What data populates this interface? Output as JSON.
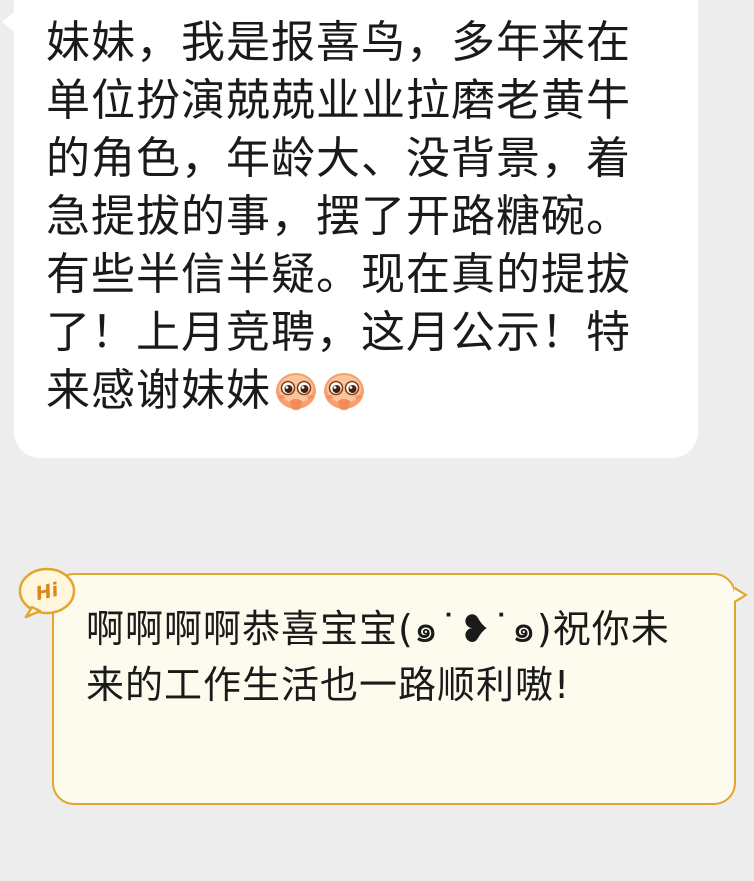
{
  "messages": {
    "incoming": {
      "text": "妹妹，我是报喜鸟，多年来在单位扮演兢兢业业拉磨老黄牛的角色，年龄大、没背景，着急提拔的事，摆了开路糖碗。有些半信半疑。现在真的提拔了！上月竞聘，这月公示！特来感谢妹妹",
      "emoji": [
        "pleading-face-sticker-icon",
        "pleading-face-sticker-icon"
      ]
    },
    "reply": {
      "badge": "Hi",
      "text": "啊啊啊啊恭喜宝宝(๑˙❥˙๑)祝你未来的工作生活也一路顺利嗷!"
    }
  },
  "colors": {
    "background": "#ededed",
    "incoming_bubble": "#ffffff",
    "reply_bubble": "#fdfbee",
    "reply_border": "#e3a52d",
    "badge": "#d9861b"
  }
}
